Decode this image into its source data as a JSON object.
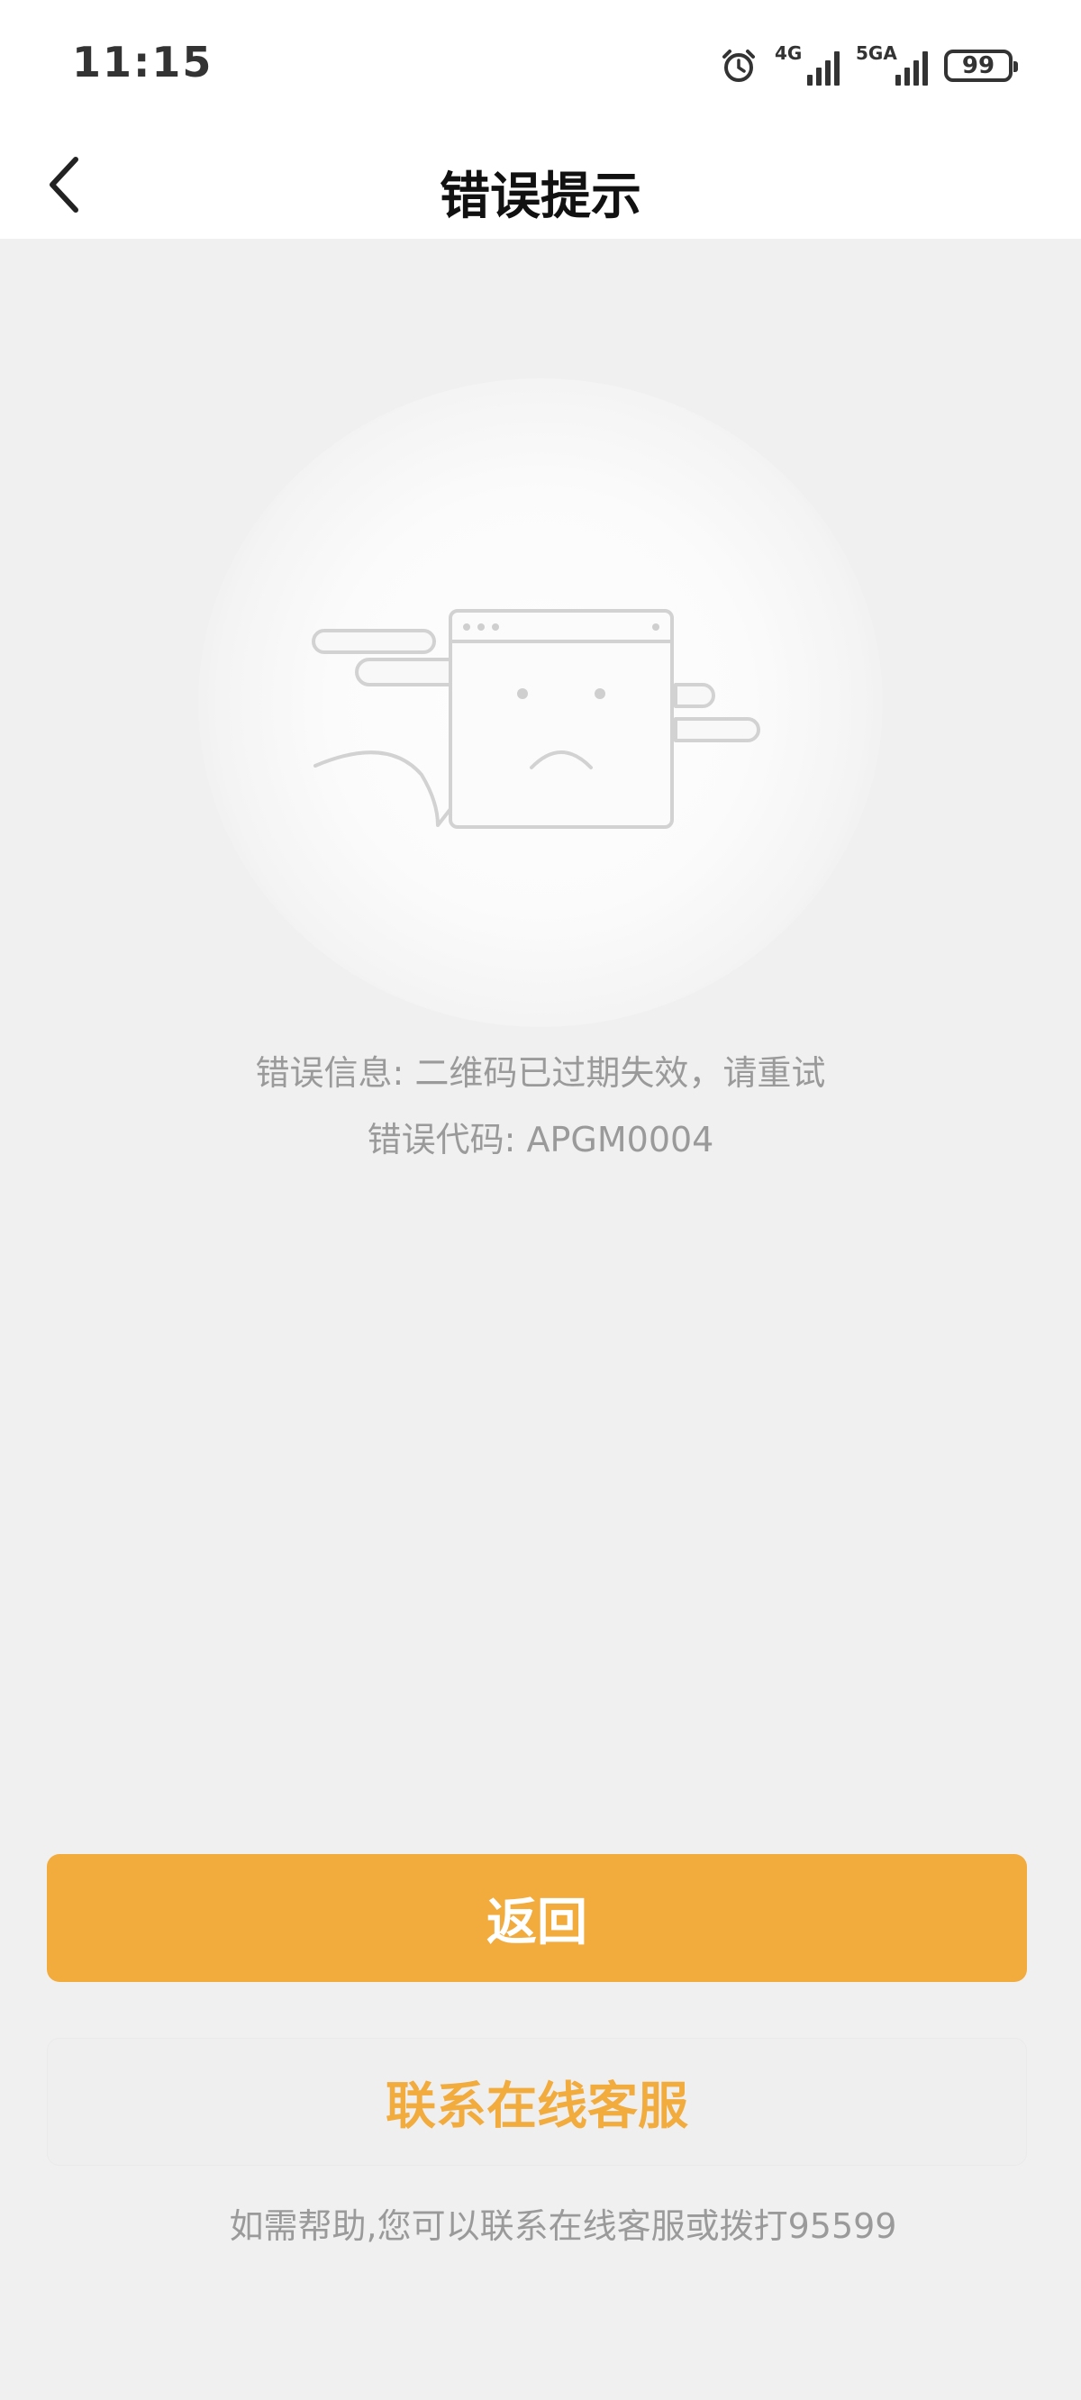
{
  "status_bar": {
    "time": "11:15",
    "network_4g": "4G",
    "network_5g": "5GA",
    "battery": "99",
    "icons": [
      "alarm-icon",
      "signal-4g-icon",
      "signal-5ga-icon",
      "battery-icon"
    ]
  },
  "nav": {
    "title": "错误提示",
    "back_icon": "chevron-left-icon"
  },
  "illustration": {
    "icon": "sad-browser-window-illustration"
  },
  "error": {
    "info": "错误信息: 二维码已过期失效，请重试",
    "code": "错误代码: APGM0004"
  },
  "actions": {
    "back_label": "返回",
    "contact_label": "联系在线客服"
  },
  "help": {
    "text": "如需帮助,您可以联系在线客服或拨打95599"
  },
  "colors": {
    "accent": "#f2ab3d",
    "background": "#f0f0f0",
    "muted_text": "#9a9a9a"
  }
}
